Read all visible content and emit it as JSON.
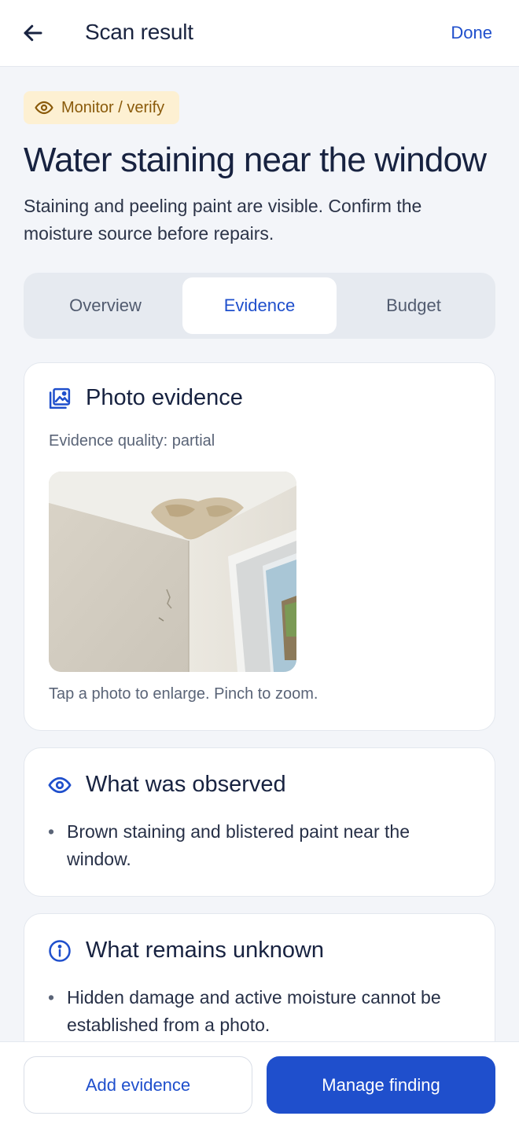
{
  "header": {
    "title": "Scan result",
    "done_label": "Done"
  },
  "badge": {
    "label": "Monitor / verify",
    "icon": "eye-icon"
  },
  "finding": {
    "title": "Water staining near the window",
    "subtitle": "Staining and peeling paint are visible. Confirm the moisture source before repairs."
  },
  "tabs": [
    {
      "label": "Overview",
      "active": false
    },
    {
      "label": "Evidence",
      "active": true
    },
    {
      "label": "Budget",
      "active": false
    }
  ],
  "photo_card": {
    "title": "Photo evidence",
    "icon": "image-gallery-icon",
    "quality": "Evidence quality: partial",
    "hint": "Tap a photo to enlarge. Pinch to zoom."
  },
  "observed_card": {
    "title": "What was observed",
    "icon": "eye-icon",
    "items": [
      "Brown staining and blistered paint near the window."
    ]
  },
  "unknown_card": {
    "title": "What remains unknown",
    "icon": "info-circle-icon",
    "items": [
      "Hidden damage and active moisture cannot be established from a photo."
    ]
  },
  "footer": {
    "secondary_label": "Add evidence",
    "primary_label": "Manage finding"
  },
  "colors": {
    "accent": "#1f4fcc",
    "badge_bg": "#fdf0d2",
    "badge_text": "#8a5a0a",
    "background": "#f3f5f9"
  }
}
